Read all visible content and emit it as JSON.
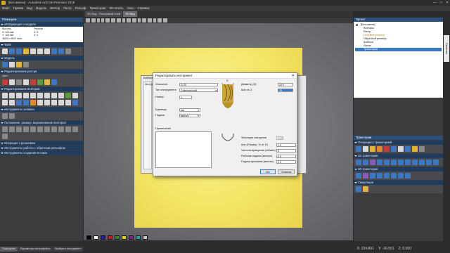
{
  "window": {
    "title": "[Без имени] - Autodesk ArtCAM Premium 2018",
    "controls": [
      "—",
      "□",
      "✕"
    ]
  },
  "menu": [
    "Файл",
    "Правка",
    "Вид",
    "Модель",
    "Вектор",
    "Растр",
    "Рельеф",
    "Траектории",
    "3D-печать",
    "Окно",
    "Справка"
  ],
  "left_panel": {
    "title": "Помощник",
    "sections": {
      "info": "Информация о модели",
      "file": "Файл",
      "model": "Модель",
      "raster": "Редактирование растра",
      "vector": "Редактирование векторов",
      "fill": "Инструменты заливки",
      "position": "Положение, размер, выравнивание векторов",
      "relief_ops": "Операции с рельефом",
      "relief_tools": "Инструменты работы с обратным рельефом",
      "inserts": "Инструменты создания вставок"
    },
    "info_box": {
      "lines": [
        "Высота:",
        "X: 100 мм",
        "Y: 100 мм",
        "4600 x 4600 пикс."
      ],
      "relief_label": "Рельеф",
      "relief_lines": [
        "Z: 0",
        "Z: 0"
      ]
    },
    "color_label": "Цвет"
  },
  "tabs": [
    "2D Вид - Растровый слой",
    "3D Вид"
  ],
  "dialog": {
    "title": "Редактировать инструмент",
    "close": "✕",
    "description_label": "Описание",
    "description_value": "D 25",
    "tool_type_label": "Тип инструмента",
    "tool_type_value": "Сферический",
    "number_label": "Номер",
    "number_value": "1",
    "units_label": "Единицы",
    "units_value": "мм",
    "feed_label": "Подача",
    "feed_value": "мм/сек",
    "notes_label": "Примечания",
    "diameter_label": "Диаметр (D)",
    "diameter_value": "25.0",
    "stepdown_label": "Шаг по Z",
    "stepdown_value": "25",
    "tool_width": "D",
    "params": [
      {
        "label": "Фиксация смещения",
        "value": "10.0"
      },
      {
        "label": "Шаг (Размер, % от D)",
        "value": "1.0"
      },
      {
        "label": "Частота вращения (об/мин)",
        "value": "0"
      },
      {
        "label": "Рабочая подача (мм/сек)",
        "value": "0.0"
      },
      {
        "label": "Подача врезания (мм/сек)",
        "value": "0.0"
      }
    ],
    "ok": "OK",
    "cancel": "Отмена"
  },
  "behind_dialog": {
    "title": "Библиотека инструментов",
    "sidebar_label": "Инструм"
  },
  "right_panel": {
    "project_title": "Проект",
    "project_tree": [
      {
        "label": "[Без имени]",
        "selected": false
      },
      {
        "label": "Векторы",
        "selected": false
      },
      {
        "label": "Растр",
        "selected": false
      },
      {
        "label": "Лицевой рельеф",
        "selected": false
      },
      {
        "label": "Обратный рельеф",
        "selected": false
      },
      {
        "label": "Шаблон",
        "selected": false
      },
      {
        "label": "Листы",
        "selected": false
      },
      {
        "label": "Траектории",
        "selected": true
      }
    ],
    "side_tab": "Свойства",
    "paths_title": "Траектории",
    "paths_sections": [
      "Операции с траекторией",
      "2D траектории",
      "3D траектории",
      "Симуляция"
    ]
  },
  "status": {
    "tabs": [
      "Помощник",
      "Параметры интерфейса",
      "Выбрать инструмент"
    ],
    "x": "X: 234.891",
    "y": "Y: -20.561",
    "z": "Z: 0.000"
  },
  "swatch_colors": [
    "#000000",
    "#ffffff",
    "#2020a0",
    "#c02020",
    "#2a8a2a",
    "#d8d02a",
    "#7a2a8a",
    "#20a0a0",
    "#c8c8c8"
  ],
  "colors": {
    "accent": "#3b78c4",
    "material": "#f3e462",
    "panel_header": "#1f3b5e"
  }
}
